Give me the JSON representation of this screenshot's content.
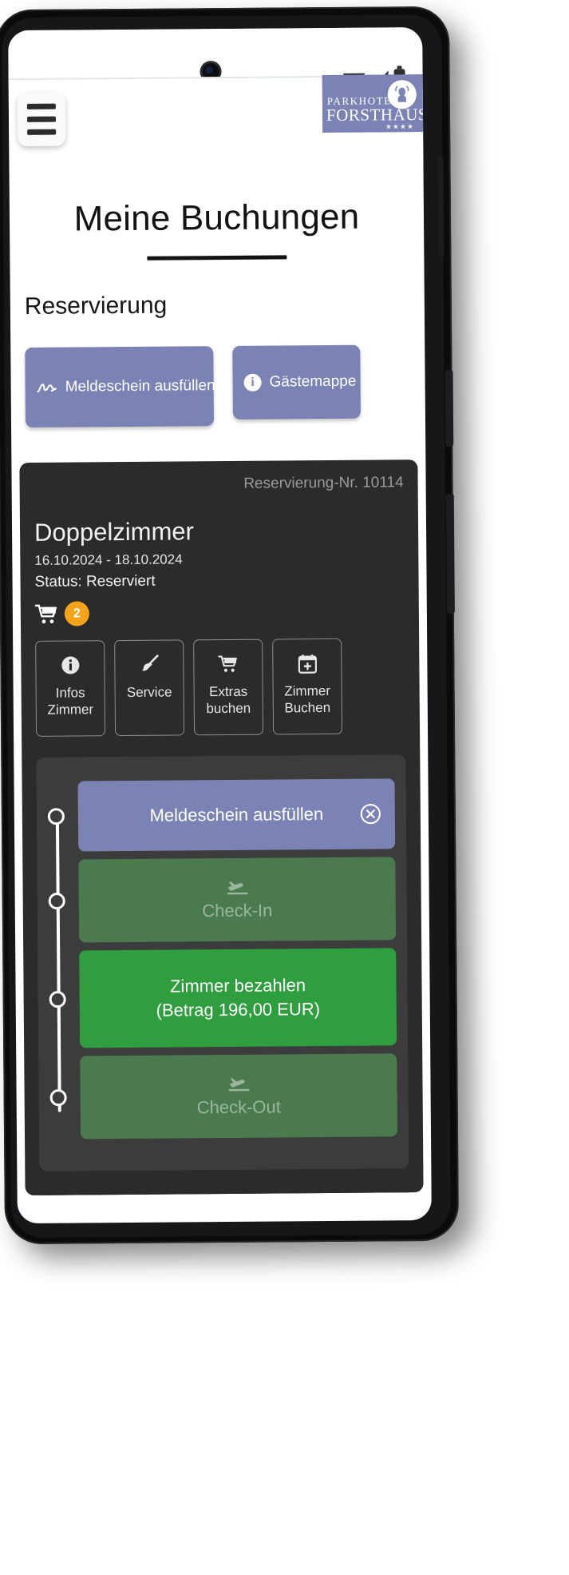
{
  "status_bar": {
    "icons": [
      "wifi-triangle-icon",
      "signal-bars-icon",
      "battery-icon"
    ]
  },
  "header": {
    "menu_icon": "hamburger-menu-icon",
    "logo": {
      "line1": "PARKHOTEL",
      "line2": "FORSTHAUS",
      "stars": "★★★★",
      "emblem": "deer-antler-icon",
      "background_color": "#7b83b4"
    }
  },
  "page": {
    "title": "Meine Buchungen",
    "section_label": "Reservierung"
  },
  "quick_actions": [
    {
      "label": "Meldeschein ausfüllen",
      "icon": "signature-pen-icon"
    },
    {
      "label": "Gästemappe",
      "icon": "info-circle-icon"
    }
  ],
  "booking": {
    "reservation_no": "Reservierung-Nr. 10114",
    "room_type": "Doppelzimmer",
    "dates": "16.10.2024 - 18.10.2024",
    "status": "Status: Reserviert",
    "cart": {
      "icon": "shopping-cart-icon",
      "count": "2",
      "badge_color": "#f5a31a"
    }
  },
  "action_tiles": [
    {
      "label": "Infos\nZimmer",
      "icon": "info-circle-icon"
    },
    {
      "label": "Service",
      "icon": "broom-icon"
    },
    {
      "label": "Extras\nbuchen",
      "icon": "shopping-cart-icon"
    },
    {
      "label": "Zimmer\nBuchen",
      "icon": "calendar-plus-icon"
    }
  ],
  "timeline": [
    {
      "label": "Meldeschein ausfüllen",
      "state": "active",
      "color": "#7b83b4",
      "trailing_icon": "cancel-circle-icon"
    },
    {
      "label": "Check-In",
      "state": "disabled",
      "color": "#4b7a4f",
      "leading_icon": "plane-landing-icon"
    },
    {
      "label_line1": "Zimmer bezahlen",
      "label_line2": "(Betrag 196,00 EUR)",
      "state": "enabled",
      "color": "#2e9e3f"
    },
    {
      "label": "Check-Out",
      "state": "disabled",
      "color": "#4b7a4f",
      "leading_icon": "plane-takeoff-icon"
    }
  ]
}
